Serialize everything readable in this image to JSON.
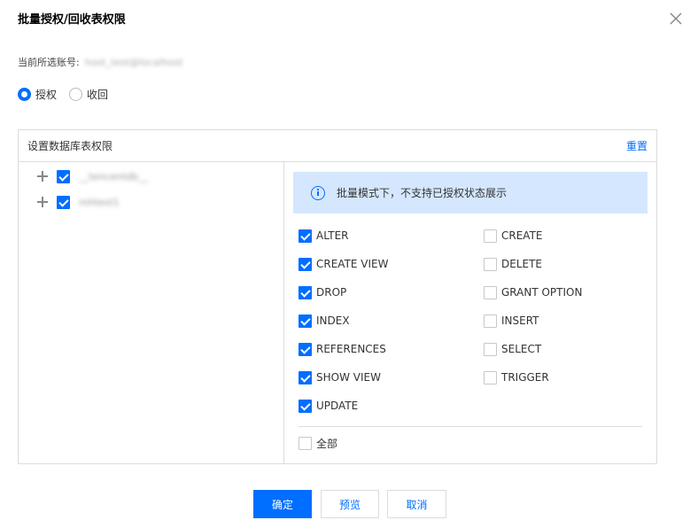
{
  "dialog": {
    "title": "批量授权/回收表权限"
  },
  "account": {
    "label": "当前所选账号:",
    "value": "host_test@localhost"
  },
  "mode": {
    "grant_label": "授权",
    "revoke_label": "收回",
    "selected": "grant"
  },
  "panel": {
    "title": "设置数据库表权限",
    "reset_label": "重置"
  },
  "tree": {
    "items": [
      {
        "label": "__tencentdb__",
        "checked": true
      },
      {
        "label": "mhtest1",
        "checked": true
      }
    ]
  },
  "info": {
    "text": "批量模式下，不支持已授权状态展示"
  },
  "privileges": {
    "left": [
      {
        "label": "ALTER",
        "checked": true
      },
      {
        "label": "CREATE VIEW",
        "checked": true
      },
      {
        "label": "DROP",
        "checked": true
      },
      {
        "label": "INDEX",
        "checked": true
      },
      {
        "label": "REFERENCES",
        "checked": true
      },
      {
        "label": "SHOW VIEW",
        "checked": true
      },
      {
        "label": "UPDATE",
        "checked": true
      }
    ],
    "right": [
      {
        "label": "CREATE",
        "checked": false
      },
      {
        "label": "DELETE",
        "checked": false
      },
      {
        "label": "GRANT OPTION",
        "checked": false
      },
      {
        "label": "INSERT",
        "checked": false
      },
      {
        "label": "SELECT",
        "checked": false
      },
      {
        "label": "TRIGGER",
        "checked": false
      }
    ],
    "all_label": "全部",
    "all_checked": false
  },
  "footer": {
    "confirm_label": "确定",
    "preview_label": "预览",
    "cancel_label": "取消"
  },
  "colors": {
    "accent": "#006eff",
    "info_bg": "#d5e7ff",
    "border": "#dcdcdc"
  }
}
